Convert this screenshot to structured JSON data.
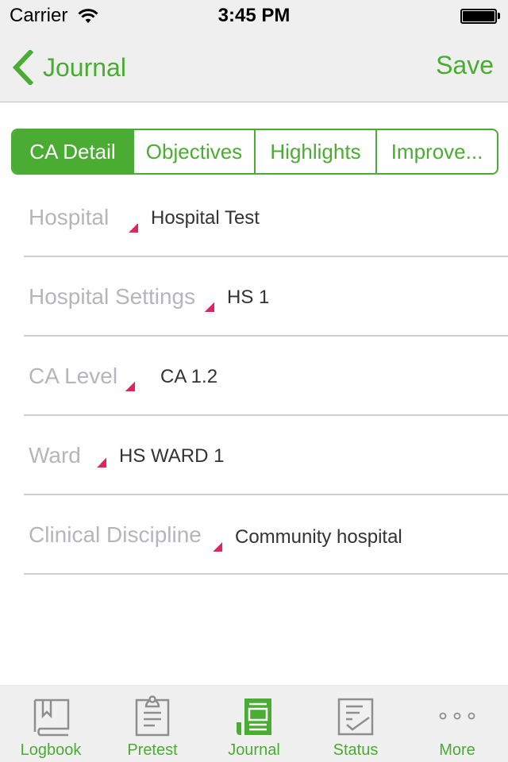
{
  "status_bar": {
    "carrier": "Carrier",
    "time": "3:45 PM",
    "battery_level": 1.0
  },
  "nav": {
    "back_label": "Journal",
    "save_label": "Save"
  },
  "colors": {
    "accent": "#4aac32",
    "required_marker": "#e0245e",
    "label_grey": "#b5b5bc",
    "value_text": "#333333",
    "inactive_icon": "#8e8e8e"
  },
  "segments": [
    {
      "label": "CA Detail",
      "active": true
    },
    {
      "label": "Objectives",
      "active": false
    },
    {
      "label": "Highlights",
      "active": false
    },
    {
      "label": "Improve...",
      "active": false
    }
  ],
  "form": {
    "rows": [
      {
        "label": "Hospital",
        "value": "Hospital Test",
        "required": true
      },
      {
        "label": "Hospital Settings",
        "value": "HS 1",
        "required": true
      },
      {
        "label": "CA Level",
        "value": "CA 1.2",
        "required": true
      },
      {
        "label": "Ward",
        "value": "HS WARD 1",
        "required": true
      },
      {
        "label": "Clinical Discipline",
        "value": "Community hospital",
        "required": true
      }
    ]
  },
  "tab_bar": {
    "items": [
      {
        "label": "Logbook",
        "icon": "book-icon",
        "selected": false
      },
      {
        "label": "Pretest",
        "icon": "clipboard-icon",
        "selected": false
      },
      {
        "label": "Journal",
        "icon": "journal-icon",
        "selected": true
      },
      {
        "label": "Status",
        "icon": "checklist-icon",
        "selected": false
      },
      {
        "label": "More",
        "icon": "more-dots-icon",
        "selected": false
      }
    ]
  }
}
